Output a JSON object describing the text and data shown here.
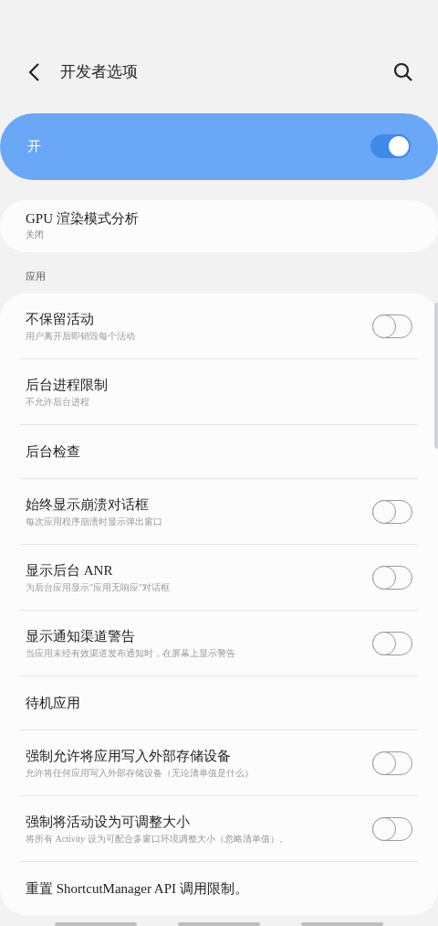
{
  "header": {
    "title": "开发者选项"
  },
  "master": {
    "label": "开",
    "on": true
  },
  "gpu": {
    "title": "GPU 渲染模式分析",
    "subtitle": "关闭"
  },
  "section": {
    "label": "应用"
  },
  "rows": [
    {
      "kind": "toggle",
      "title": "不保留活动",
      "subtitle": "用户离开后即销毁每个活动",
      "on": false
    },
    {
      "kind": "plain",
      "title": "后台进程限制",
      "subtitle": "不允许后台进程"
    },
    {
      "kind": "plain",
      "title": "后台检查"
    },
    {
      "kind": "toggle",
      "title": "始终显示崩溃对话框",
      "subtitle": "每次应用程序崩溃时显示弹出窗口",
      "on": false
    },
    {
      "kind": "toggle",
      "title": "显示后台 ANR",
      "subtitle": "为后台应用显示\"应用无响应\"对话框",
      "on": false
    },
    {
      "kind": "toggle",
      "title": "显示通知渠道警告",
      "subtitle": "当应用未经有效渠道发布通知时，在屏幕上显示警告",
      "on": false
    },
    {
      "kind": "plain",
      "title": "待机应用"
    },
    {
      "kind": "toggle",
      "title": "强制允许将应用写入外部存储设备",
      "subtitle": "允许将任何应用写入外部存储设备（无论清单值是什么）",
      "on": false
    },
    {
      "kind": "toggle",
      "title": "强制将活动设为可调整大小",
      "subtitle": "将所有 Activity 设为可配合多窗口环境调整大小（忽略清单值）。",
      "on": false
    },
    {
      "kind": "plain",
      "title": "重置 ShortcutManager API 调用限制。"
    }
  ]
}
